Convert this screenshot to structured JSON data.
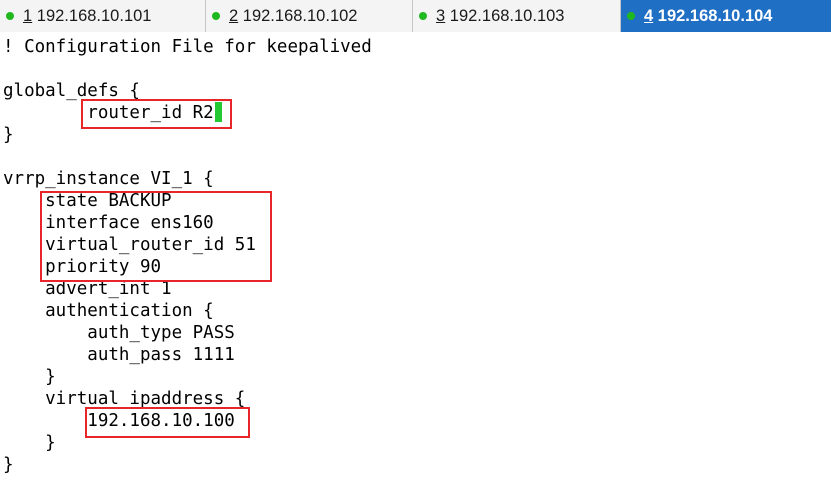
{
  "colors": {
    "accent": "#1f6fc5",
    "tab_dot": "#1fb81f",
    "cursor": "#22c932",
    "highlight": "#e8262a"
  },
  "tabs": [
    {
      "number": "1",
      "host": "192.168.10.101",
      "active": false
    },
    {
      "number": "2",
      "host": "192.168.10.102",
      "active": false
    },
    {
      "number": "3",
      "host": "192.168.10.103",
      "active": false
    },
    {
      "number": "4",
      "host": "192.168.10.104",
      "active": true
    }
  ],
  "terminal": {
    "lines": [
      "! Configuration File for keepalived",
      "",
      "global_defs {",
      "        router_id R2",
      "}",
      "",
      "vrrp_instance VI_1 {",
      "    state BACKUP",
      "    interface ens160",
      "    virtual_router_id 51",
      "    priority 90",
      "    advert_int 1",
      "    authentication {",
      "        auth_type PASS",
      "        auth_pass 1111",
      "    }",
      "    virtual_ipaddress {",
      "        192.168.10.100",
      "    }",
      "}"
    ]
  }
}
